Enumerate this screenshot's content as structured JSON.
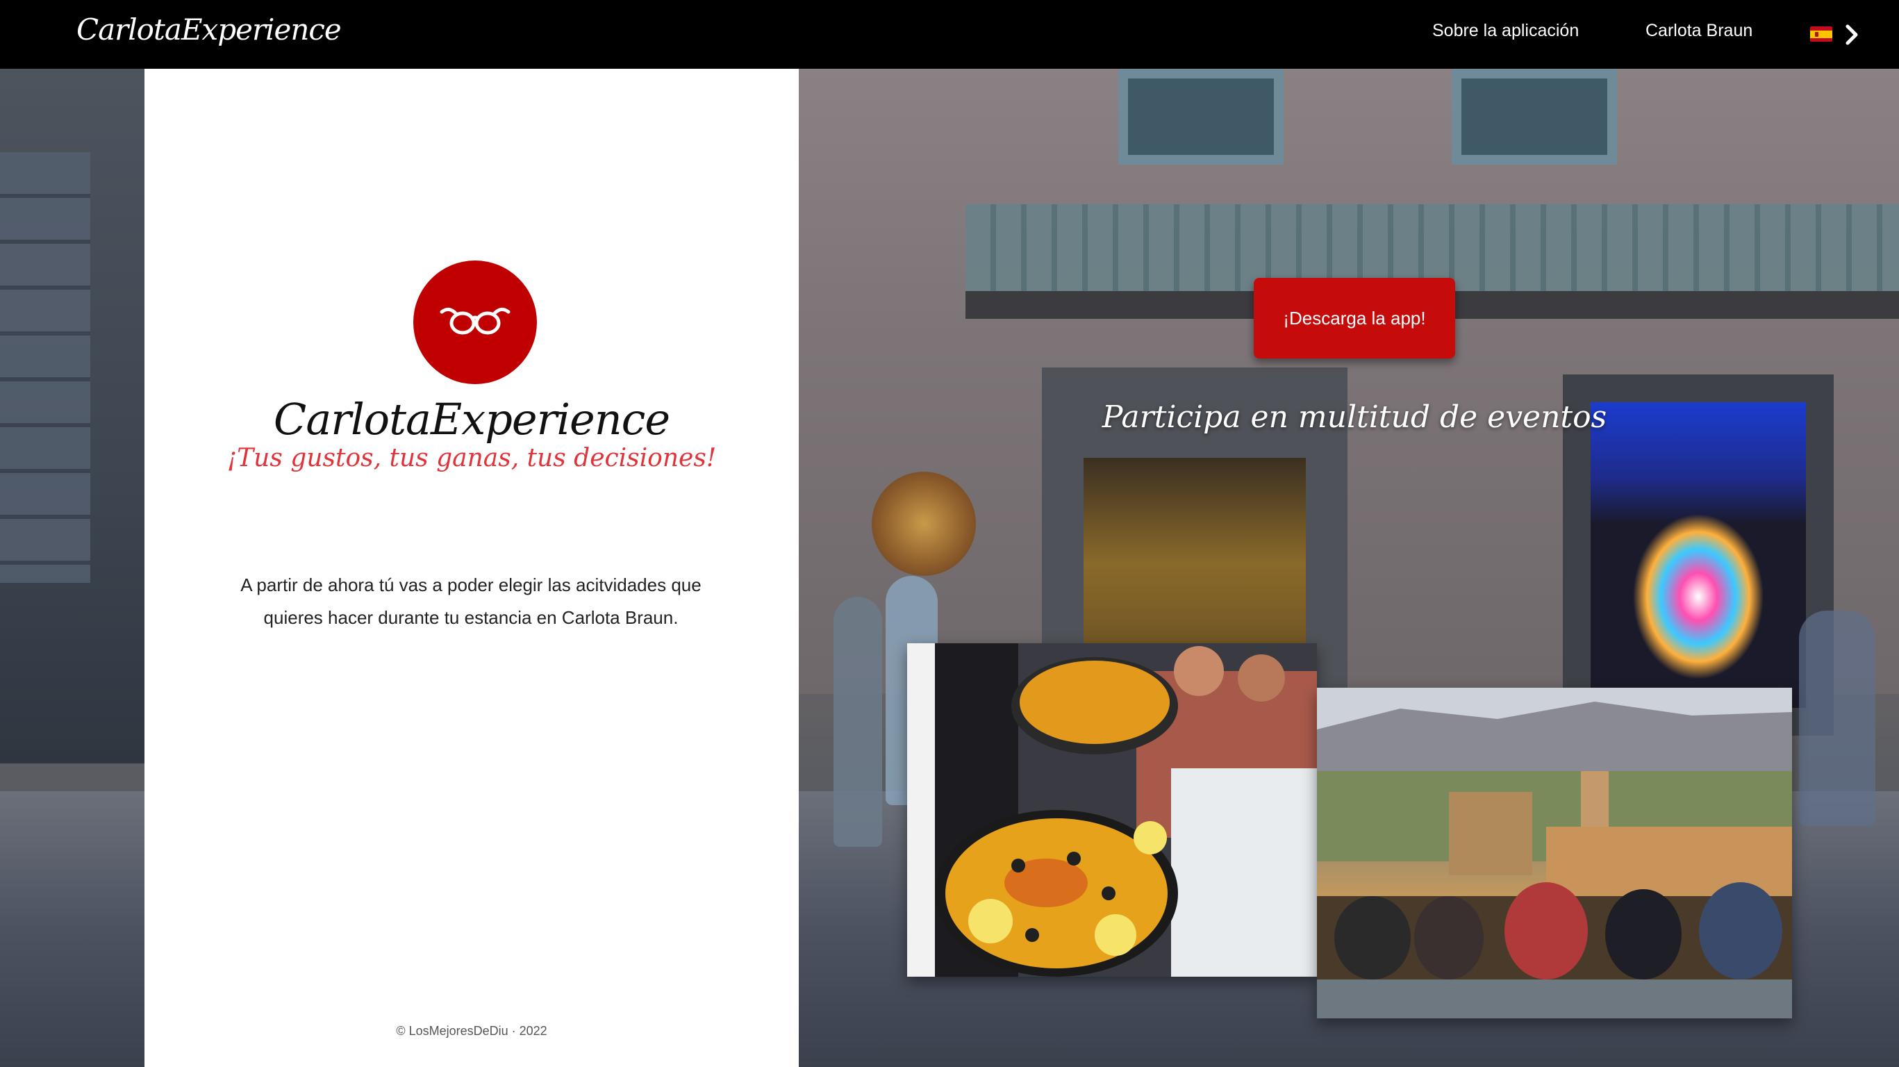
{
  "navbar": {
    "brand": "CarlotaExperience",
    "links": {
      "about": "Sobre la aplicación",
      "carlota": "Carlota Braun"
    },
    "language_icon": "spain-flag-icon",
    "next_icon": "chevron-right-icon"
  },
  "left_panel": {
    "logo_icon": "glasses-icon",
    "logo_color": "#c00000",
    "title": "CarlotaExperience",
    "tagline": "¡Tus gustos,  tus ganas, tus decisiones!",
    "tagline_color": "#e0343a",
    "intro": "A partir de ahora tú vas a poder elegir las acitvidades que quieres hacer durante tu estancia  en Carlota Braun.",
    "footer": "© LosMejoresDeDiu · 2022"
  },
  "hero": {
    "cta_label": "¡Descarga la app!",
    "cta_color": "#c60b0b",
    "events_tagline": "Participa en multitud de eventos",
    "images": [
      "paella-photo",
      "alhambra-photo"
    ]
  }
}
